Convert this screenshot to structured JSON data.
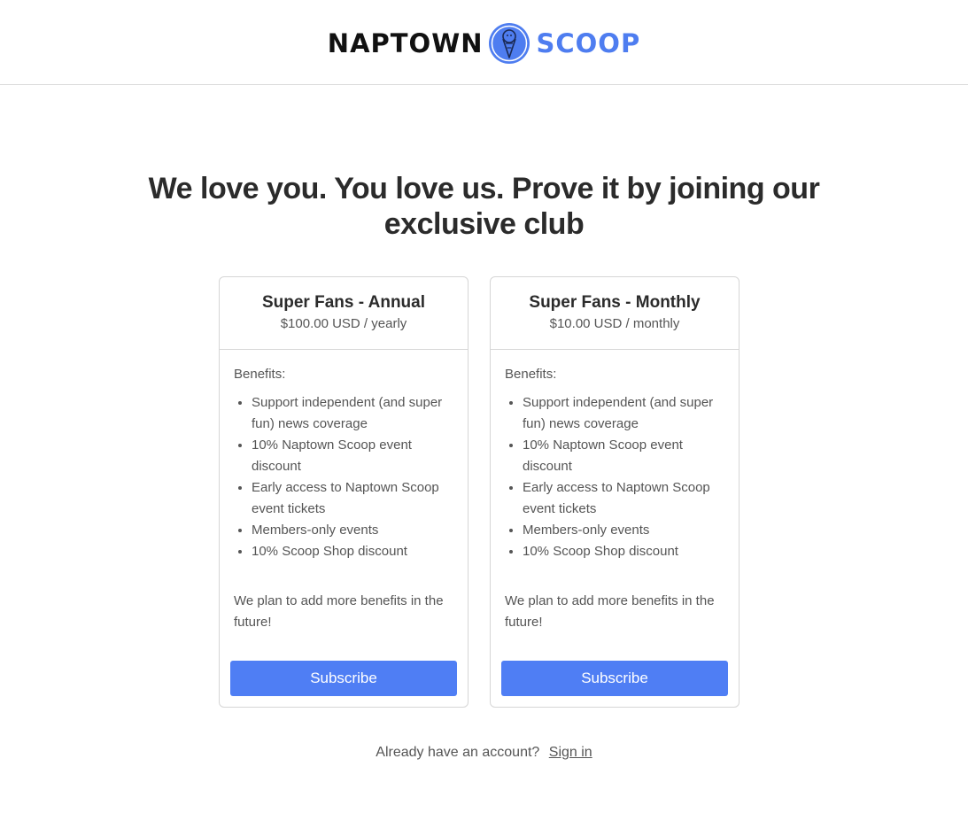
{
  "header": {
    "logo_word_1": "NAPTOWN",
    "logo_word_2": "SCOOP",
    "logo_icon": "ice-cream-cone-icon"
  },
  "headline": "We love you. You love us. Prove it by joining our exclusive club",
  "plans": [
    {
      "name": "Super Fans - Annual",
      "price": "$100.00 USD / yearly",
      "benefits_label": "Benefits:",
      "benefits": [
        "Support independent (and super fun) news coverage",
        "10% Naptown Scoop event discount",
        "Early access to Naptown Scoop event tickets",
        "Members-only events",
        "10% Scoop Shop discount"
      ],
      "note": "We plan to add more benefits in the future!",
      "button_label": "Subscribe"
    },
    {
      "name": "Super Fans - Monthly",
      "price": "$10.00 USD / monthly",
      "benefits_label": "Benefits:",
      "benefits": [
        "Support independent (and super fun) news coverage",
        "10% Naptown Scoop event discount",
        "Early access to Naptown Scoop event tickets",
        "Members-only events",
        "10% Scoop Shop discount"
      ],
      "note": "We plan to add more benefits in the future!",
      "button_label": "Subscribe"
    }
  ],
  "footer": {
    "prompt": "Already have an account?",
    "sign_in_label": "Sign in"
  },
  "colors": {
    "accent": "#4f7ef4",
    "logo_blue": "#4e7df0"
  }
}
